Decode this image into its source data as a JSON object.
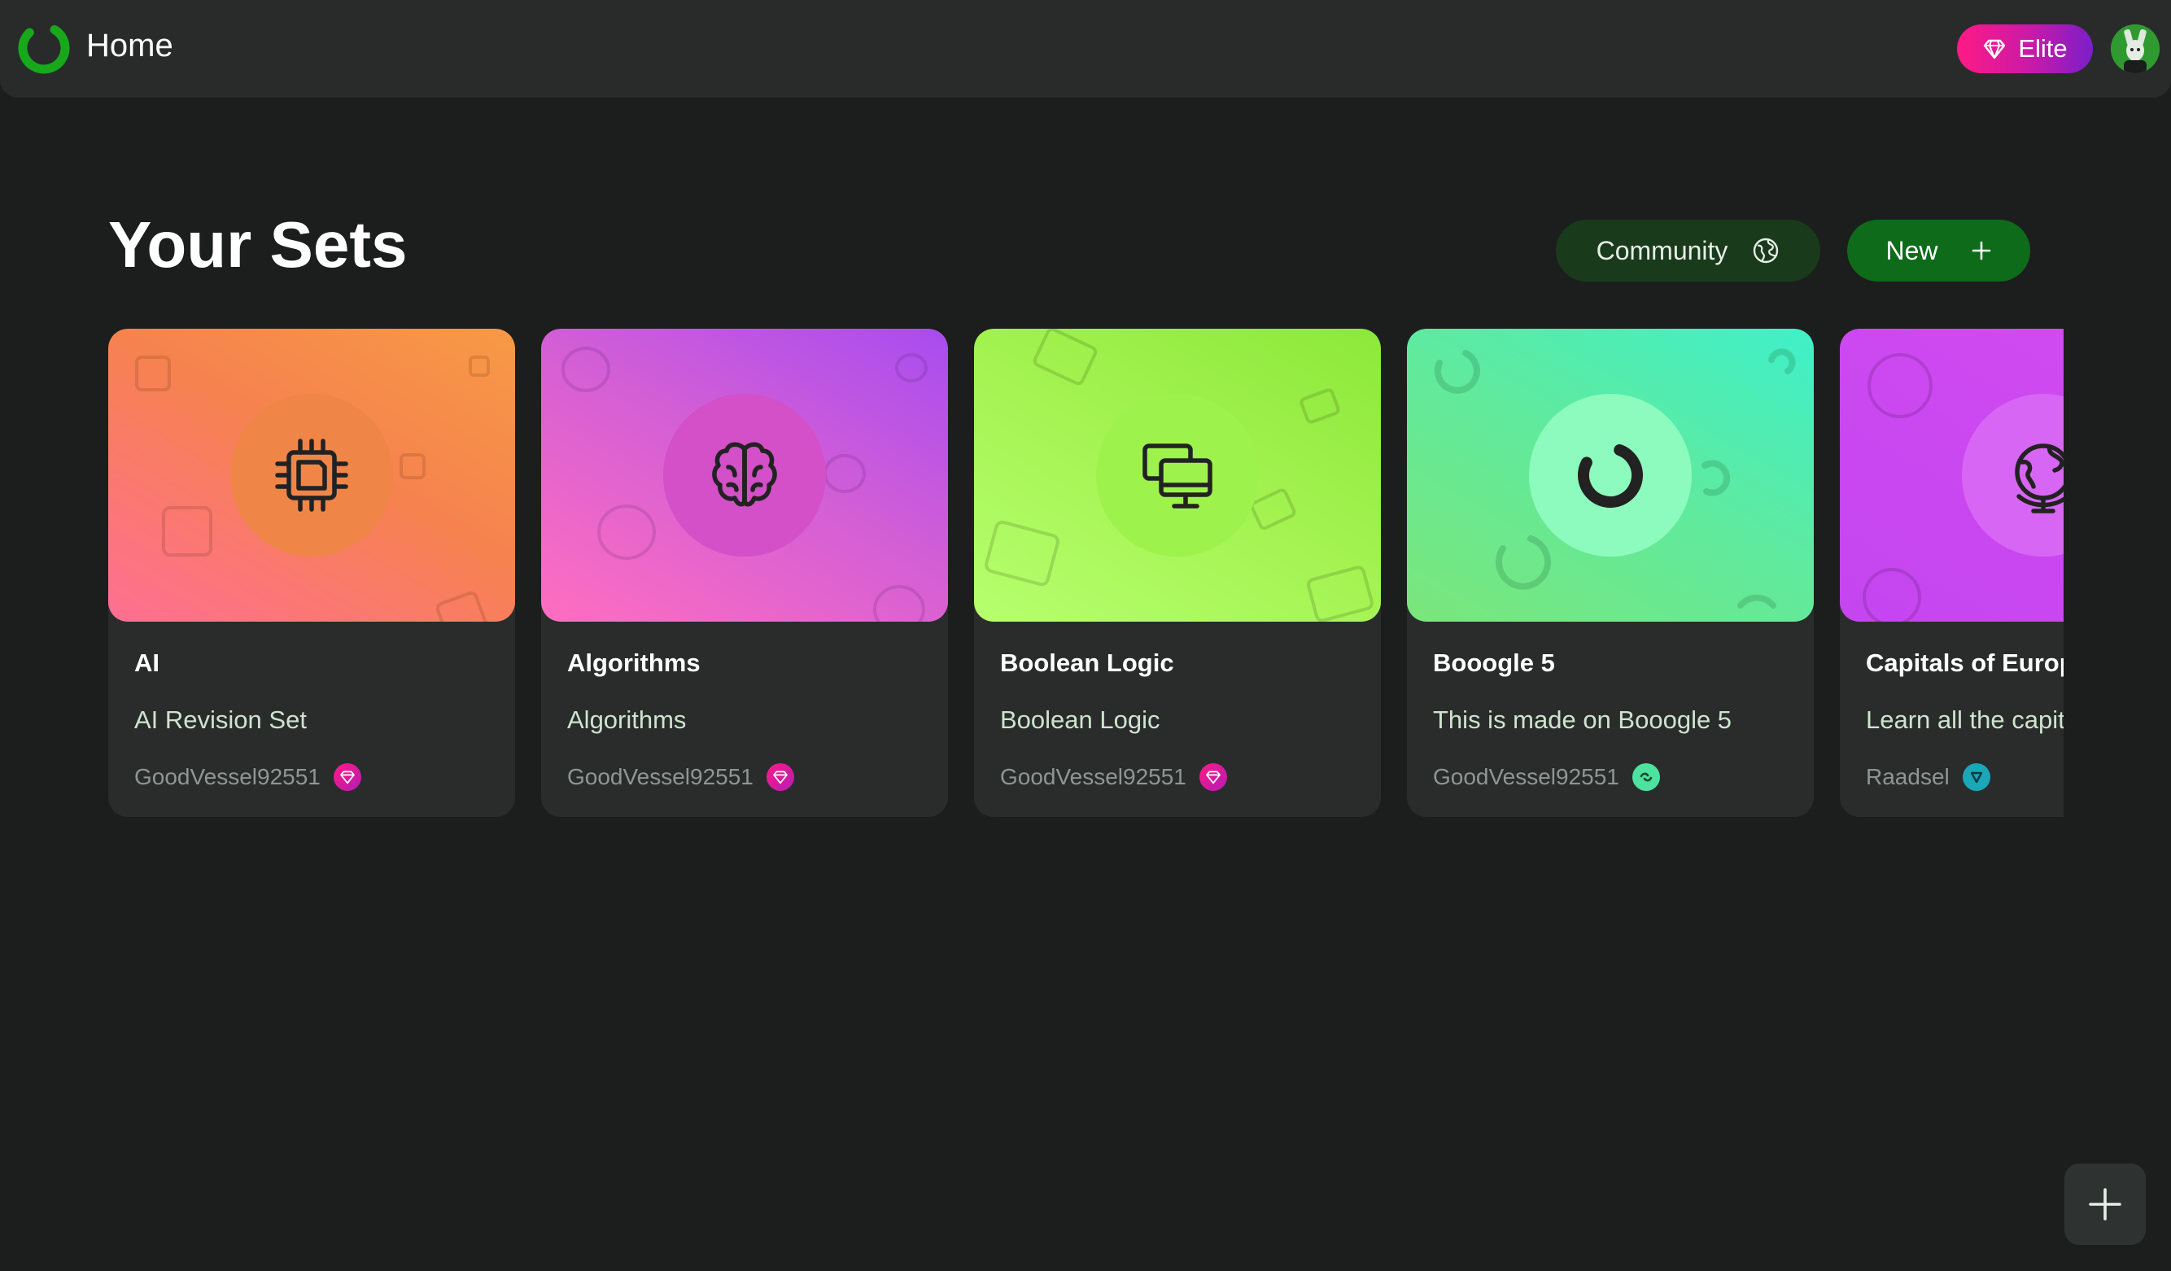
{
  "header": {
    "title": "Home",
    "logo_icon": "spinner-ring-logo",
    "elite_label": "Elite",
    "elite_icon": "diamond-icon",
    "avatar_icon": "user-avatar"
  },
  "main": {
    "title": "Your Sets",
    "community_label": "Community",
    "community_icon": "globe-icon",
    "new_label": "New",
    "new_icon": "plus-icon"
  },
  "cards": [
    {
      "title": "AI",
      "description": "AI Revision Set",
      "author": "GoodVessel92551",
      "icon": "cpu-chip-icon",
      "badge": "elite-diamond-badge",
      "colors": {
        "from": "#ff6f93",
        "to": "#f79a45",
        "circle": "#f08548"
      }
    },
    {
      "title": "Algorithms",
      "description": "Algorithms",
      "author": "GoodVessel92551",
      "icon": "brain-icon",
      "badge": "elite-diamond-badge",
      "colors": {
        "from": "#ff6ec0",
        "to": "#a84cf0",
        "circle": "#d350c9"
      }
    },
    {
      "title": "Boolean Logic",
      "description": "Boolean Logic",
      "author": "GoodVessel92551",
      "icon": "computers-icon",
      "badge": "elite-diamond-badge",
      "colors": {
        "from": "#b6ff6e",
        "to": "#8de83a",
        "circle": "#9ef24c"
      }
    },
    {
      "title": "Booogle 5",
      "description": "This is made on Booogle 5",
      "author": "GoodVessel92551",
      "icon": "spinner-icon",
      "badge": "green-badge",
      "colors": {
        "from": "#7be67a",
        "to": "#3ff0c9",
        "circle": "#8dfbbd"
      }
    },
    {
      "title": "Capitals of Europe",
      "description": "Learn all the capitals of Europe",
      "author": "Raadsel",
      "icon": "globe-icon",
      "badge": "teal-badge",
      "colors": {
        "from": "#c446f0",
        "to": "#d24cf2",
        "circle": "#d866f4"
      }
    }
  ],
  "fab": {
    "icon": "plus-icon"
  },
  "colors": {
    "background": "#1c1e1d",
    "topbar": "#282b2a",
    "card": "#292c2b",
    "accent_green": "#0e6b1a",
    "community_green": "#1a3a1c"
  }
}
